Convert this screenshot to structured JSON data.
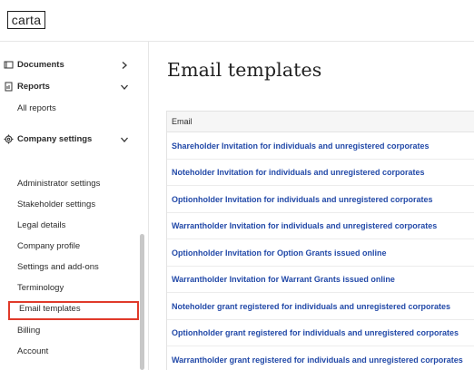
{
  "app": {
    "logo_text": "carta"
  },
  "sidebar": {
    "documents_label": "Documents",
    "reports_label": "Reports",
    "all_reports_label": "All reports",
    "company_settings_label": "Company settings",
    "settings_items": [
      {
        "label": "Administrator settings"
      },
      {
        "label": "Stakeholder settings"
      },
      {
        "label": "Legal details"
      },
      {
        "label": "Company profile"
      },
      {
        "label": "Settings and add-ons"
      },
      {
        "label": "Terminology"
      },
      {
        "label": "Email templates",
        "selected": true
      },
      {
        "label": "Billing"
      },
      {
        "label": "Account"
      }
    ]
  },
  "main": {
    "title": "Email templates",
    "table": {
      "column_header": "Email",
      "rows": [
        "Shareholder Invitation for individuals and unregistered corporates",
        "Noteholder Invitation for individuals and unregistered corporates",
        "Optionholder Invitation for individuals and unregistered corporates",
        "Warrantholder Invitation for individuals and unregistered corporates",
        "Optionholder Invitation for Option Grants issued online",
        "Warrantholder Invitation for Warrant Grants issued online",
        "Noteholder grant registered for individuals and unregistered corporates",
        "Optionholder grant registered for individuals and unregistered corporates",
        "Warrantholder grant registered for individuals and unregistered corporates"
      ]
    }
  },
  "colors": {
    "link": "#2249a8",
    "highlight_border": "#e03a2a"
  },
  "icons": {
    "documents": "folder-icon",
    "reports": "report-icon",
    "company_settings": "gear-icon"
  }
}
